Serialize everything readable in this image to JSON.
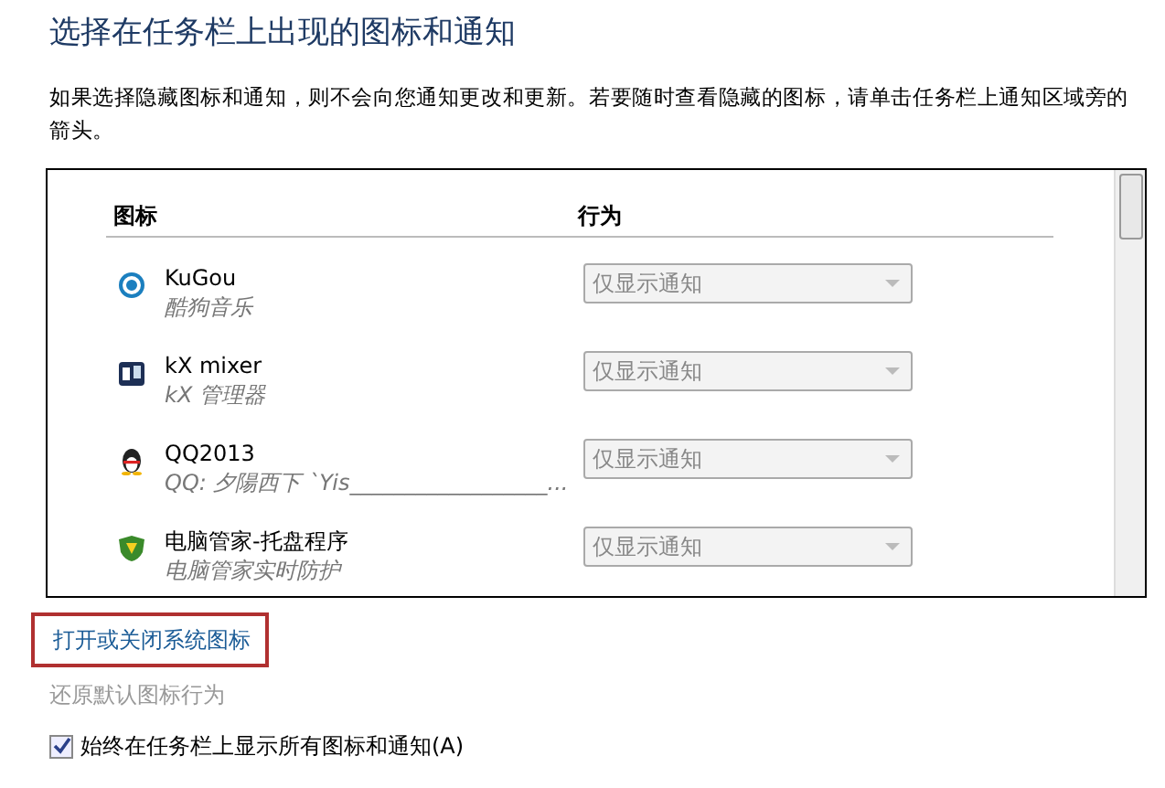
{
  "title": "选择在任务栏上出现的图标和通知",
  "description": "如果选择隐藏图标和通知，则不会向您通知更改和更新。若要随时查看隐藏的图标，请单击任务栏上通知区域旁的箭头。",
  "table": {
    "columns": [
      "图标",
      "行为"
    ],
    "rows": [
      {
        "name": "KuGou",
        "description": "酷狗音乐",
        "behavior": "仅显示通知",
        "disabled": true
      },
      {
        "name": "kX mixer",
        "description": "kX 管理器",
        "behavior": "仅显示通知",
        "disabled": true
      },
      {
        "name": "QQ2013",
        "description": "QQ: 夕陽西下 `Yis__________________...",
        "behavior": "仅显示通知",
        "disabled": true
      },
      {
        "name": "电脑管家-托盘程序",
        "description": "电脑管家实时防护",
        "behavior": "仅显示通知",
        "disabled": true
      }
    ]
  },
  "system_icons_link": {
    "label": "打开或关闭系统图标",
    "highlighted": true
  },
  "restore_link": {
    "label": "还原默认图标行为",
    "disabled": true
  },
  "always_show": {
    "label": "始终在任务栏上显示所有图标和通知(A)",
    "checked": true
  }
}
